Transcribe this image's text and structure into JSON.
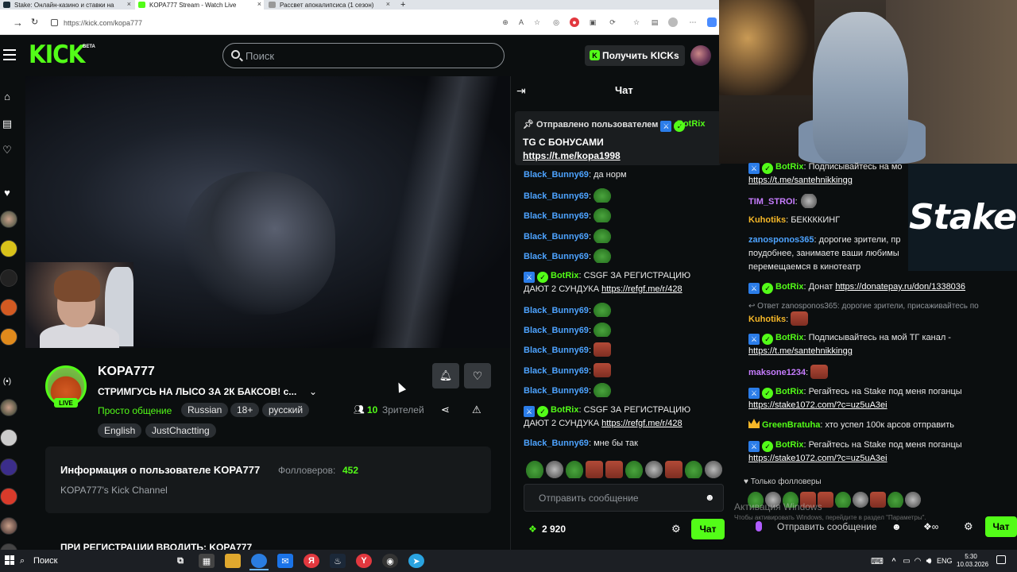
{
  "browser": {
    "tabs": [
      {
        "label": "Stake: Онлайн-казино и ставки на",
        "active": false
      },
      {
        "label": "KOPA777 Stream - Watch Live",
        "active": true
      },
      {
        "label": "Рассвет апокалипсиса (1 сезон)",
        "active": false
      }
    ],
    "url": "https://kick.com/kopa777"
  },
  "header": {
    "logo": "KICK",
    "logo_beta": "BETA",
    "search_placeholder": "Поиск",
    "get_kicks_label": "Получить KICKs"
  },
  "channel": {
    "live_badge": "LIVE",
    "name": "KOPA777",
    "title": "СТРИМГУСЬ НА ЛЫСО ЗА 2К БАКСОВ! с...",
    "category": "Просто общение",
    "tags": [
      "Russian",
      "18+",
      "русский",
      "English",
      "JustChactting"
    ],
    "viewers_count": "10",
    "viewers_label": "Зрителей",
    "about_title": "Информация о пользователе KOPA777",
    "followers_label": "Фолловеров:",
    "followers_count": "452",
    "about_desc": "KOPA777's Kick Channel",
    "promo_text": "ПРИ РЕГИСТРАЦИИ ВВОДИТЬ: KOPA777"
  },
  "chat": {
    "title": "Чат",
    "pinned_label": "Отправлено пользователем",
    "pinned_user": "BotRix",
    "pinned_line1": "TG С БОНУСАМИ",
    "pinned_line2": "https://t.me/kopa1998",
    "messages": [
      {
        "user": "Black_Bunny69",
        "color": "#4da3ff",
        "text": "да норм"
      },
      {
        "user": "Black_Bunny69",
        "color": "#4da3ff",
        "text": ""
      },
      {
        "user": "Black_Bunny69",
        "color": "#4da3ff",
        "text": ""
      },
      {
        "user": "Black_Bunny69",
        "color": "#4da3ff",
        "text": ""
      },
      {
        "user": "Black_Bunny69",
        "color": "#4da3ff",
        "text": ""
      },
      {
        "user": "BotRix",
        "color": "#53fc18",
        "text": "CSGF ЗА РЕГИСТРАЦИЮ",
        "text2": "ДАЮТ 2 СУНДУКА",
        "link": "https://refgf.me/r/428"
      },
      {
        "user": "Black_Bunny69",
        "color": "#4da3ff",
        "text": ""
      },
      {
        "user": "Black_Bunny69",
        "color": "#4da3ff",
        "text": ""
      },
      {
        "user": "Black_Bunny69",
        "color": "#4da3ff",
        "text": ""
      },
      {
        "user": "Black_Bunny69",
        "color": "#4da3ff",
        "text": ""
      },
      {
        "user": "Black_Bunny69",
        "color": "#4da3ff",
        "text": ""
      },
      {
        "user": "BotRix",
        "color": "#53fc18",
        "text": "CSGF ЗА РЕГИСТРАЦИЮ",
        "text2": "ДАЮТ 2 СУНДУКА",
        "link": "https://refgf.me/r/428"
      },
      {
        "user": "Black_Bunny69",
        "color": "#4da3ff",
        "text": "мне бы так"
      }
    ],
    "input_placeholder": "Отправить сообщение",
    "points": "2 920",
    "send_label": "Чат"
  },
  "overlay_chat": {
    "stake_logo": "Stake",
    "messages": [
      {
        "user": "BotRix",
        "text": "Подписывайтесь на мо",
        "link": "https://t.me/santehnikkingg"
      },
      {
        "user": "TIM_STROI",
        "text": ""
      },
      {
        "user": "Kuhotiks",
        "text": "БЕККККИНГ"
      },
      {
        "user": "zanosponos365",
        "text": "дорогие зрители, пр",
        "text2": "поудобнее, занимаете ваши любимы",
        "text3": "перемещаемся в кинотеатр"
      },
      {
        "user": "BotRix",
        "text": "Донат",
        "link": "https://donatepay.ru/don/1338036"
      },
      {
        "user": "Kuhotiks",
        "text": ""
      },
      {
        "user": "BotRix",
        "text": "Подписывайтесь на мой ТГ канал -",
        "link": "https://t.me/santehnikkingg"
      },
      {
        "user": "maksone1234",
        "text": ""
      },
      {
        "user": "BotRix",
        "text": "Регайтесь на Stake под меня поганцы",
        "link": "https://stake1072.com/?c=uz5uA3ei"
      },
      {
        "user": "GreenBratuha",
        "text": "хто успел 100к арсов отправить"
      },
      {
        "user": "BotRix",
        "text": "Регайтесь на Stake под меня поганцы",
        "link": "https://stake1072.com/?c=uz5uA3ei"
      }
    ],
    "reply_line": "Ответ zanosponos365: дорогие зрители, присаживайтесь по",
    "followers_only": "Только фолловеры",
    "input_placeholder": "Отправить сообщение",
    "send_label": "Чат",
    "win_activate": "Активация Windows",
    "win_activate2": "Чтобы активировать Windows, перейдите в раздел \"Параметры\"."
  },
  "taskbar": {
    "search_label": "Поиск",
    "lang": "ENG",
    "time": "5:30",
    "date": "10.03.2026"
  }
}
